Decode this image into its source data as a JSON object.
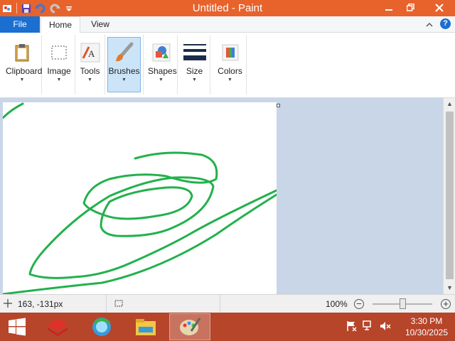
{
  "window": {
    "title": "Untitled - Paint",
    "controls": {
      "minimize": "minimize",
      "restore": "restore",
      "close": "close"
    }
  },
  "quick_access": [
    "save-icon",
    "undo-icon",
    "redo-icon",
    "customize-dropdown-icon"
  ],
  "ribbon": {
    "tabs": {
      "file": "File",
      "home": "Home",
      "view": "View"
    },
    "groups": [
      {
        "label": "Clipboard",
        "icon": "clipboard-icon"
      },
      {
        "label": "Image",
        "icon": "image-select-icon"
      },
      {
        "label": "Tools",
        "icon": "tools-icon"
      },
      {
        "label": "Brushes",
        "icon": "brush-icon",
        "selected": true
      },
      {
        "label": "Shapes",
        "icon": "shapes-icon"
      },
      {
        "label": "Size",
        "icon": "line-size-icon"
      },
      {
        "label": "Colors",
        "icon": "color-palette-icon"
      }
    ]
  },
  "canvas": {
    "stroke_color": "#22b14c"
  },
  "status": {
    "cursor_position": "163, -131px",
    "zoom": "100%",
    "zoom_level": 1.0
  },
  "taskbar": {
    "apps": [
      "windows-start-icon",
      "red-app-icon",
      "browser-icon",
      "file-explorer-icon",
      "paint-icon"
    ],
    "active_app": "paint-icon",
    "tray": [
      "action-center-flag-icon",
      "network-icon",
      "volume-muted-icon"
    ],
    "time": "3:30 PM",
    "date": "10/30/2025"
  },
  "colors": {
    "titlebar": "#e8622c",
    "file_tab": "#1a6fd1",
    "taskbar": "#b6452a",
    "selected_tool": "#cce4f7"
  }
}
